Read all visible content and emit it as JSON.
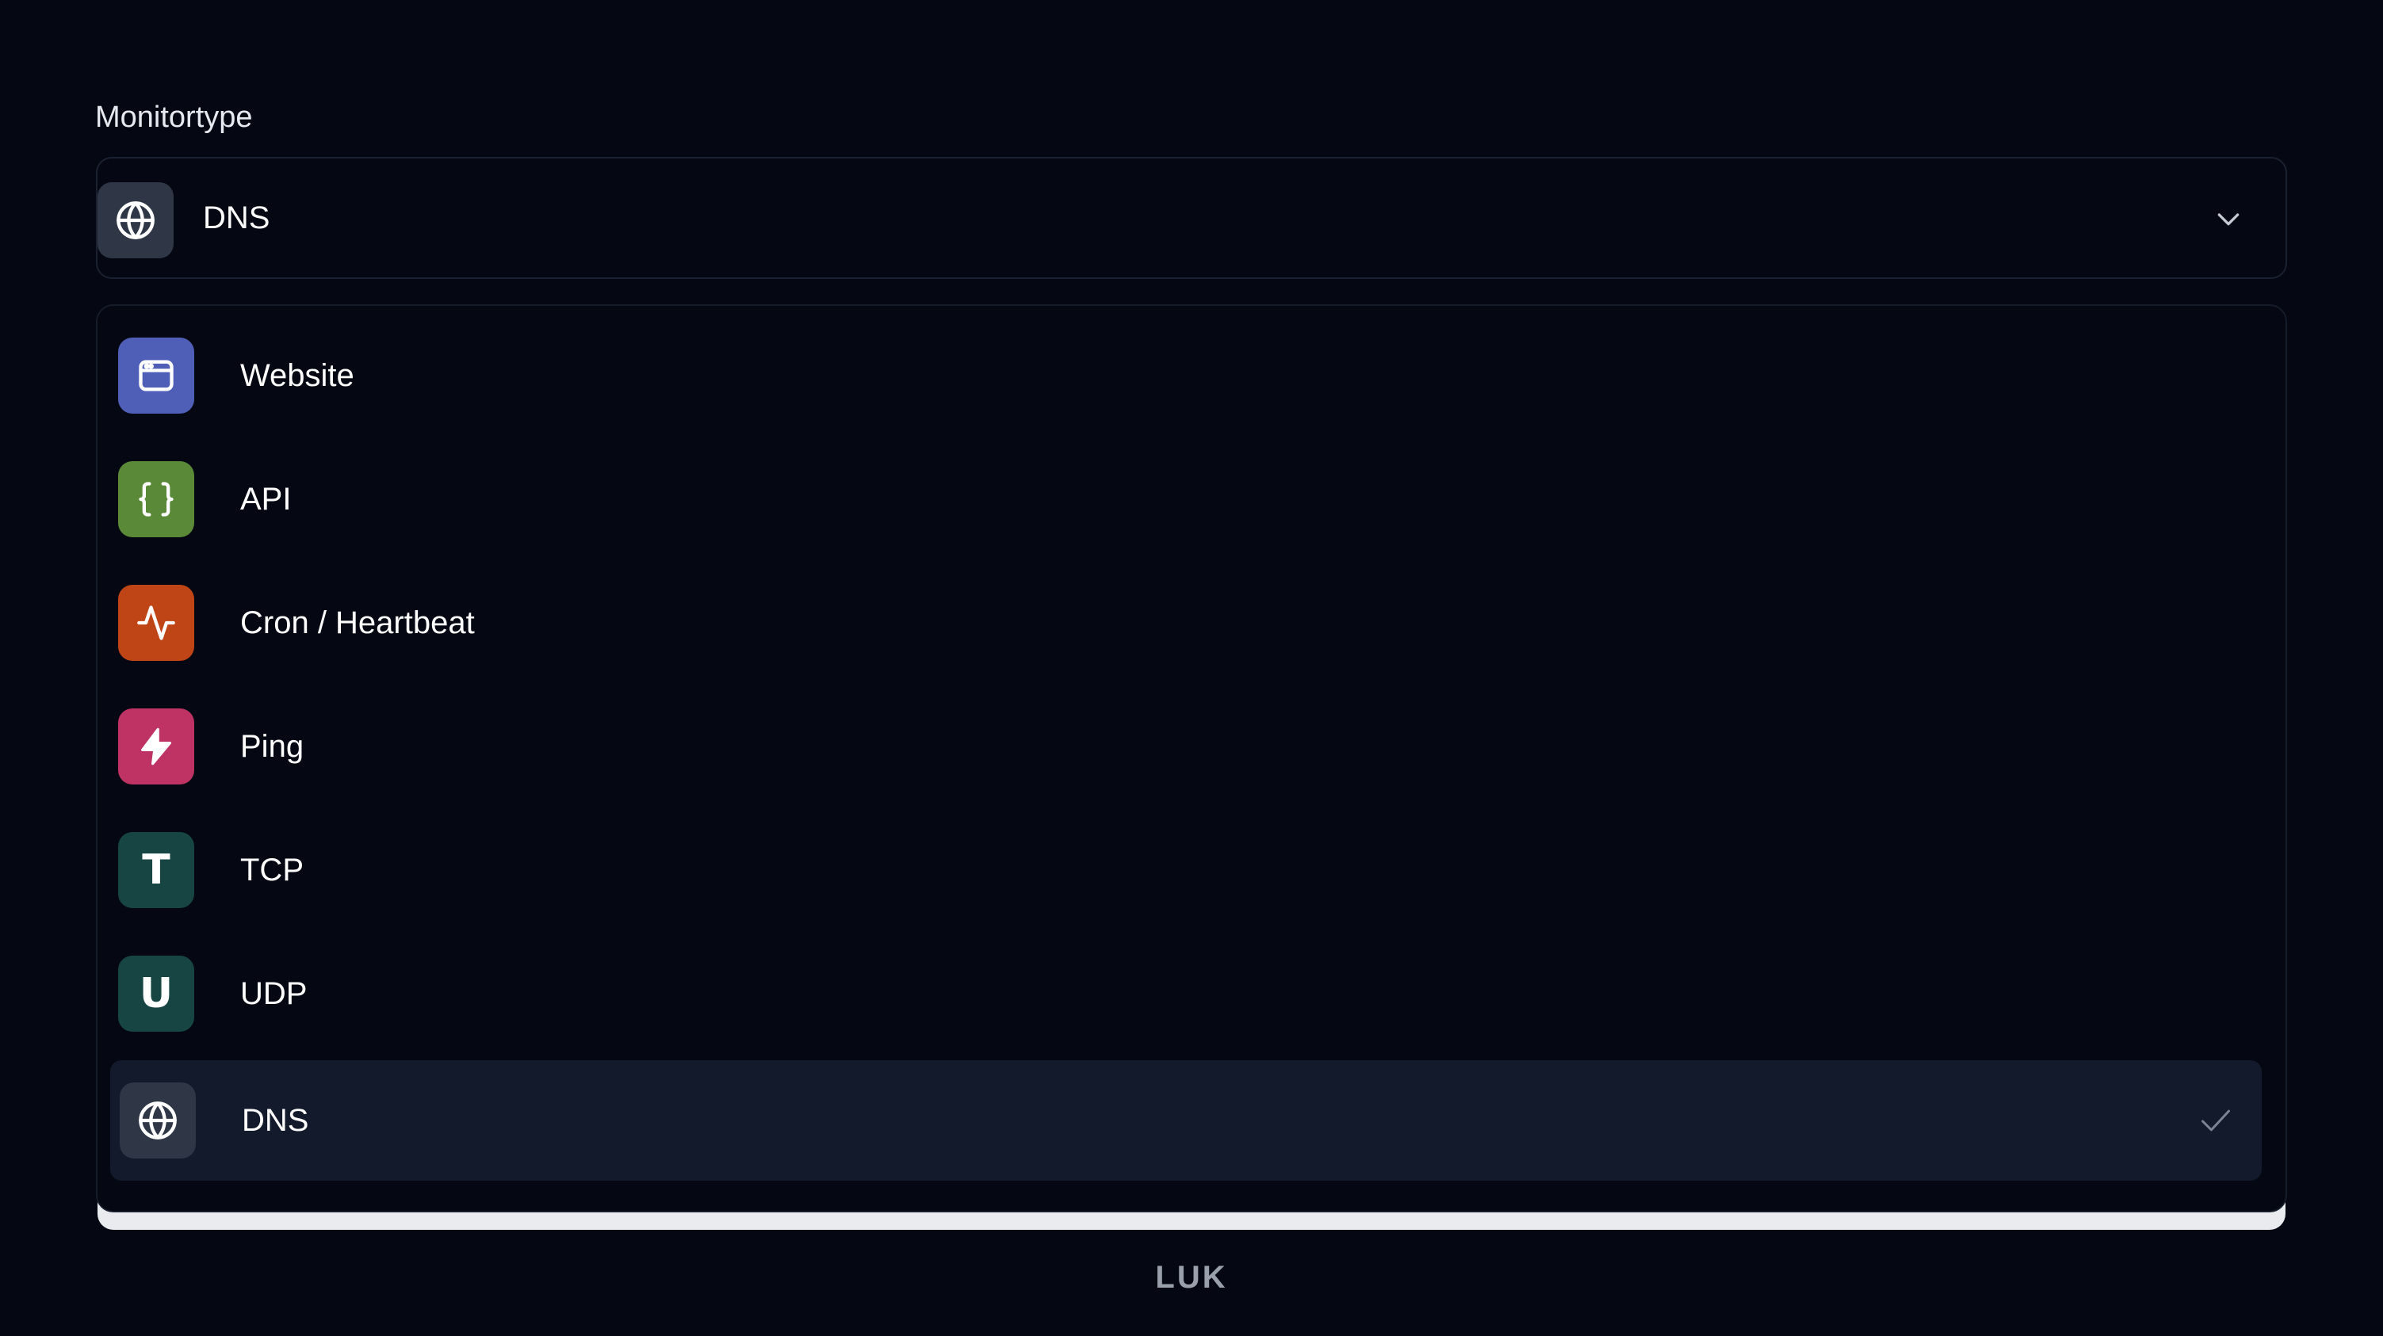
{
  "form": {
    "label": "Monitortype"
  },
  "select": {
    "value": "DNS",
    "icon": "globe-icon",
    "icon_color": "#2f3747"
  },
  "options": [
    {
      "label": "Website",
      "icon": "browser-window-icon",
      "color": "#4f5fb8"
    },
    {
      "label": "API",
      "icon": "curly-braces-icon",
      "color": "#5a8a38"
    },
    {
      "label": "Cron / Heartbeat",
      "icon": "activity-icon",
      "color": "#bf4516"
    },
    {
      "label": "Ping",
      "icon": "lightning-bolt-icon",
      "color": "#be3363"
    },
    {
      "label": "TCP",
      "icon": "letter-t-icon",
      "glyph": "T",
      "color": "#174543"
    },
    {
      "label": "UDP",
      "icon": "letter-u-icon",
      "glyph": "U",
      "color": "#174543"
    },
    {
      "label": "DNS",
      "icon": "globe-icon",
      "color": "#2f3747",
      "selected": true
    }
  ],
  "footer": {
    "logo": "LUK"
  }
}
